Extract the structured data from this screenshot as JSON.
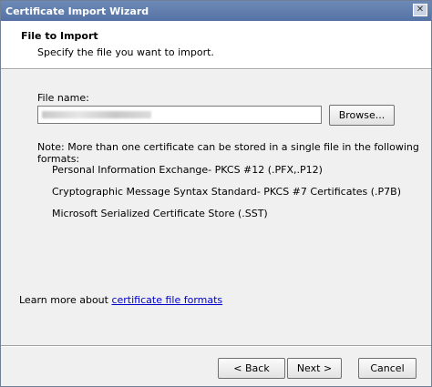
{
  "window": {
    "title": "Certificate Import Wizard"
  },
  "header": {
    "title": "File to Import",
    "subtitle": "Specify the file you want to import."
  },
  "file": {
    "label": "File name:",
    "value": "",
    "browse_label": "Browse..."
  },
  "note": {
    "text": "Note:  More than one certificate can be stored in a single file in the following formats:",
    "formats": [
      "Personal Information Exchange- PKCS #12 (.PFX,.P12)",
      "Cryptographic Message Syntax Standard- PKCS #7 Certificates (.P7B)",
      "Microsoft Serialized Certificate Store (.SST)"
    ]
  },
  "learn_more": {
    "prefix": "Learn more about ",
    "link": "certificate file formats"
  },
  "buttons": {
    "back": "< Back",
    "next": "Next >",
    "cancel": "Cancel"
  }
}
